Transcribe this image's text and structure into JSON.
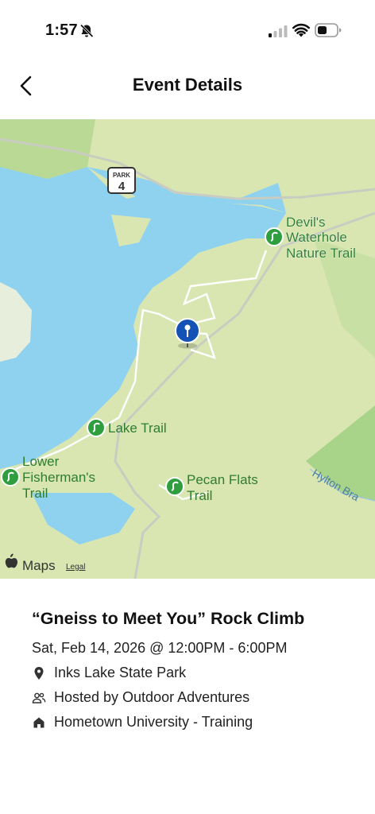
{
  "status_bar": {
    "time": "1:57",
    "icons": [
      "bell-slash-icon",
      "cellular-signal-icon",
      "wifi-icon",
      "battery-icon"
    ]
  },
  "nav": {
    "title": "Event Details",
    "back_icon": "chevron-left-icon"
  },
  "map": {
    "park_badge_top": "PARK",
    "park_badge_number": "4",
    "labels": {
      "devils_1": "Devil's",
      "devils_2": "Waterhole",
      "devils_3": "Nature Trail",
      "lake_trail": "Lake Trail",
      "lower_1": "Lower",
      "lower_2": "Fisherman's",
      "lower_3": "Trail",
      "pecan_1": "Pecan Flats",
      "pecan_2": "Trail",
      "hylton": "Hylton Bra"
    },
    "attribution": "Maps",
    "legal": "Legal",
    "colors": {
      "water": "#8fd2f0",
      "land": "#d9e6b2",
      "forest": "#a8d48a",
      "trail_label": "#2e7d32",
      "pin": "#1452b5"
    }
  },
  "event": {
    "title": "“Gneiss to Meet You” Rock Climb",
    "datetime": "Sat, Feb 14, 2026 @ 12:00PM - 6:00PM",
    "location": "Inks Lake State Park",
    "host": "Hosted by Outdoor Adventures",
    "org": "Hometown University - Training"
  }
}
